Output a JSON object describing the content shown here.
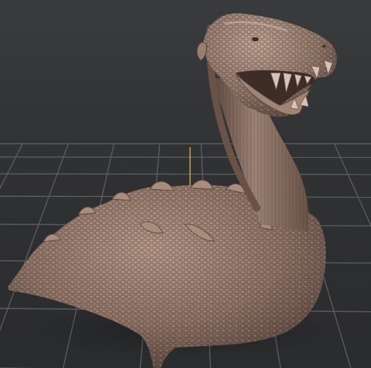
{
  "viewport": {
    "background_color": "#303133",
    "grid": true,
    "grid_color": "#5d5e60",
    "vertical_axis_color": "#d9a742",
    "shaded_view": true
  },
  "sculpt": {
    "subject": "dragon-bust-sculpt",
    "material_color": "#9c8172",
    "highlight_color": "#c8ad9d",
    "shadow_color": "#4e3c35"
  }
}
